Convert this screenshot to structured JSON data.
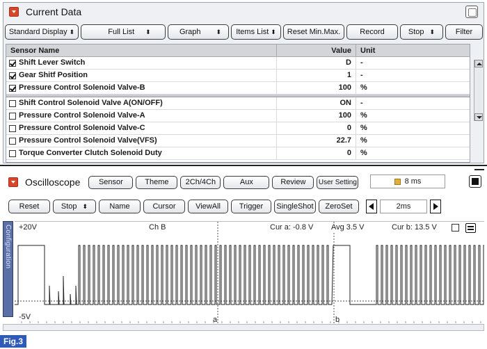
{
  "current_data": {
    "title": "Current Data",
    "toolbar": {
      "standard_display": "Standard Display",
      "full_list": "Full List",
      "graph": "Graph",
      "items_list": "Items List",
      "reset_minmax": "Reset Min.Max.",
      "record": "Record",
      "stop": "Stop",
      "filter": "Filter"
    },
    "columns": {
      "name": "Sensor Name",
      "value": "Value",
      "unit": "Unit"
    },
    "rows": [
      {
        "name": "Shift Lever Switch",
        "value": "D",
        "unit": "-",
        "checked": true
      },
      {
        "name": "Gear Shitf Position",
        "value": "1",
        "unit": "-",
        "checked": true
      },
      {
        "name": "Pressure Control Solenoid Valve-B",
        "value": "100",
        "unit": "%",
        "checked": true
      },
      {
        "name": "Shift Control Solenoid Valve A(ON/OFF)",
        "value": "ON",
        "unit": "-",
        "checked": false
      },
      {
        "name": "Pressure Control Solenoid Valve-A",
        "value": "100",
        "unit": "%",
        "checked": false
      },
      {
        "name": "Pressure Control Solenoid Valve-C",
        "value": "0",
        "unit": "%",
        "checked": false
      },
      {
        "name": "Pressure Control Solenoid Valve(VFS)",
        "value": "22.7",
        "unit": "%",
        "checked": false
      },
      {
        "name": "Torque Converter Clutch Solenoid Duty",
        "value": "0",
        "unit": "%",
        "checked": false
      }
    ]
  },
  "oscilloscope": {
    "title": "Oscilloscope",
    "header_buttons": {
      "sensor": "Sensor",
      "theme": "Theme",
      "ch": "2Ch/4Ch",
      "aux": "Aux",
      "review": "Review",
      "user_setting": "User Setting"
    },
    "sample_time": "8 ms",
    "toolbar": {
      "reset": "Reset",
      "stop": "Stop",
      "name": "Name",
      "cursor": "Cursor",
      "view_all": "ViewAll",
      "trigger": "Trigger",
      "single_shot": "SingleShot",
      "zero_set": "ZeroSet",
      "time_div": "2ms"
    },
    "side_tab": "Configuration",
    "scope": {
      "top_label": "+20V",
      "bottom_label": "-5V",
      "channel": "Ch B",
      "cursor_a": "Cur a: -0.8 V",
      "avg": "Avg  3.5 V",
      "cursor_b": "Cur b: 13.5 V",
      "marker_a": "a",
      "marker_b": "b"
    }
  },
  "figure_label": "Fig.3"
}
